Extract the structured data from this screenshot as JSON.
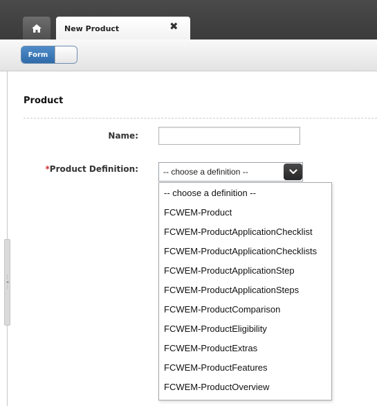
{
  "tabs": {
    "home_icon": "home-icon",
    "active_tab_label": "New Product",
    "close_icon": "close-icon"
  },
  "toolbar": {
    "form_toggle_label": "Form"
  },
  "section": {
    "title": "Product"
  },
  "fields": {
    "name_label": "Name:",
    "name_value": "",
    "definition_required_marker": "*",
    "definition_label": "Product Definition:",
    "definition_selected": "-- choose a definition --"
  },
  "dropdown": {
    "options": [
      "-- choose a definition --",
      "FCWEM-Product",
      "FCWEM-ProductApplicationChecklist",
      "FCWEM-ProductApplicationChecklists",
      "FCWEM-ProductApplicationStep",
      "FCWEM-ProductApplicationSteps",
      "FCWEM-ProductComparison",
      "FCWEM-ProductEligibility",
      "FCWEM-ProductExtras",
      "FCWEM-ProductFeatures",
      "FCWEM-ProductOverview"
    ]
  },
  "colors": {
    "topbar": "#3b3b3b",
    "toggle_accent": "#2f6ba9",
    "required": "#d32f2f"
  }
}
